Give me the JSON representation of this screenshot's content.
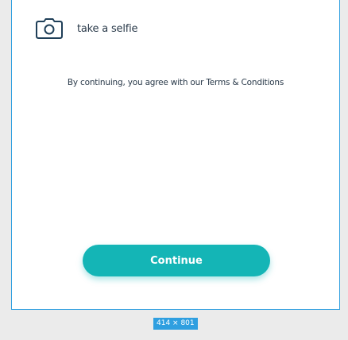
{
  "selfie": {
    "icon": "camera-icon",
    "label": "take a selfie"
  },
  "terms": {
    "prefix": "By continuing, you agree with our ",
    "link": "Terms & Conditions"
  },
  "continue_button": {
    "label": "Continue"
  },
  "frame_badge": {
    "label": "414 × 801"
  },
  "colors": {
    "accent": "#14b5b6",
    "frame_border": "#2f9fe0",
    "text": "#2a3a4a",
    "canvas": "#ebebeb"
  }
}
